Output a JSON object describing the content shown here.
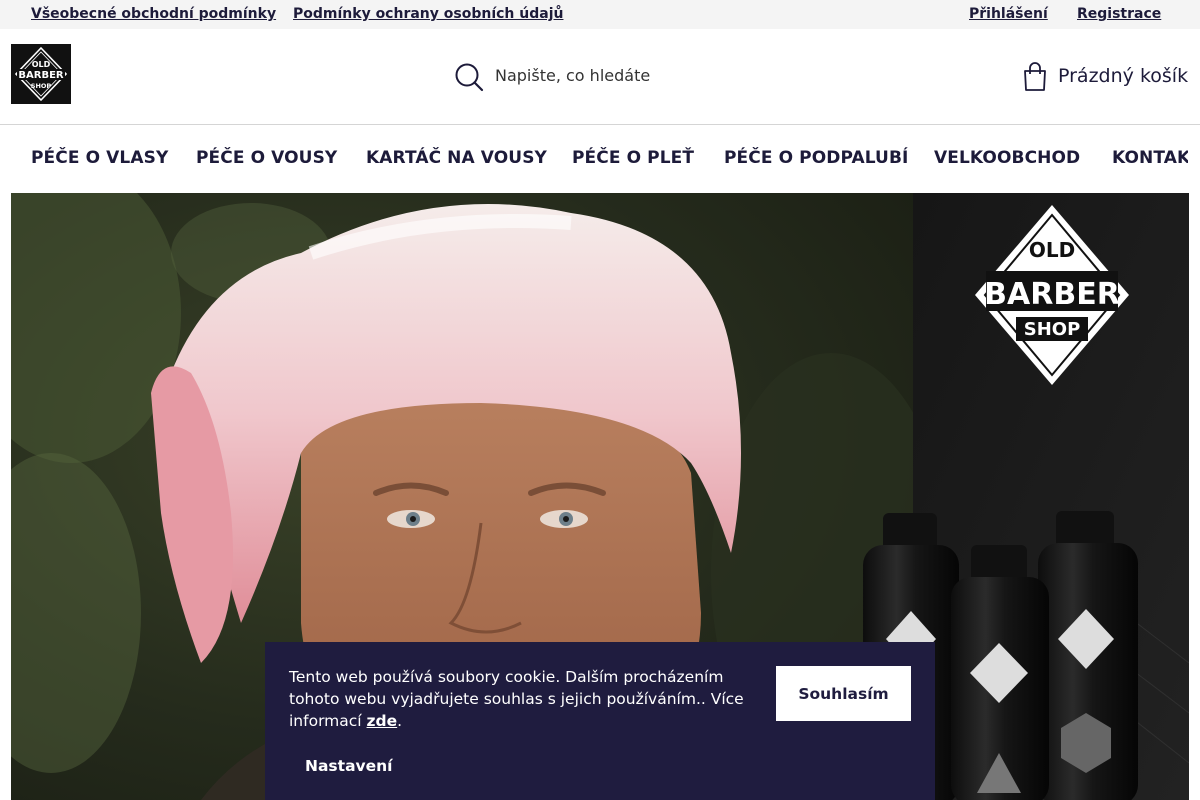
{
  "topbar": {
    "links": [
      "Všeobecné obchodní podmínky",
      "Podmínky ochrany osobních údajů"
    ],
    "account": {
      "login": "Přihlášení",
      "register": "Registrace"
    }
  },
  "header": {
    "logo_text": [
      "OLD",
      "BARBER",
      "SHOP"
    ],
    "search": {
      "placeholder": "Napište, co hledáte"
    },
    "cart": {
      "label": "Prázdný košík"
    }
  },
  "nav": {
    "items": [
      "PÉČE O VLASY",
      "PÉČE O VOUSY",
      "KARTÁČ NA VOUSY",
      "PÉČE O PLEŤ",
      "PÉČE O PODPALUBÍ",
      "VELKOOBCHOD",
      "KONTAKT"
    ]
  },
  "hero": {
    "brand_logo_text": [
      "OLD",
      "BARBER",
      "SHOP"
    ],
    "colors": {
      "right_panel": "#141414",
      "towel": "#e9a5ae",
      "skin": "#b07452",
      "foliage": "#3b4a2c"
    }
  },
  "cookie": {
    "text": "Tento web používá soubory cookie. Dalším procházením tohoto webu vyjadřujete souhlas s jejich používáním.. Více informací ",
    "link": "zde",
    "period": ".",
    "accept": "Souhlasím",
    "settings": "Nastavení"
  },
  "colors": {
    "brand_dark": "#1f1c3f",
    "text": "#1d1b3a",
    "topbar_bg": "#f4f4f4"
  }
}
